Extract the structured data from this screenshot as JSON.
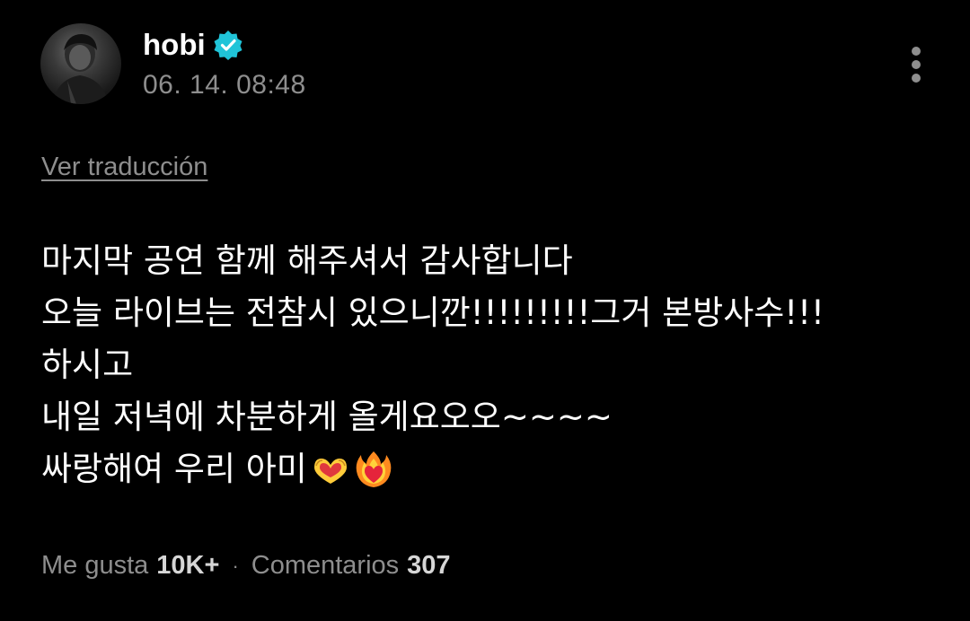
{
  "theme": {
    "background": "#000000",
    "text": "#ffffff",
    "muted": "#8e8e8e",
    "verified_color": "#20c4d8"
  },
  "post": {
    "author": {
      "name": "hobi",
      "verified": true,
      "avatar_icon": "avatar-photo"
    },
    "timestamp": "06. 14. 08:48",
    "menu_icon": "more-vertical-icon",
    "translate_link": "Ver traducción",
    "lines": [
      "마지막 공연 함께 해주셔서 감사합니다",
      "오늘 라이브는 전참시 있으니깐!!!!!!!!!그거 본방사수!!!",
      "하시고",
      "내일 저녁에 차분하게 올게요오오~~~~",
      "싸랑해여 우리 아미"
    ],
    "trailing_emojis": [
      "heart-hands-emoji",
      "heart-on-fire-emoji"
    ],
    "footer": {
      "likes_label": "Me gusta",
      "likes_count": "10K+",
      "separator": "·",
      "comments_label": "Comentarios",
      "comments_count": "307"
    }
  }
}
